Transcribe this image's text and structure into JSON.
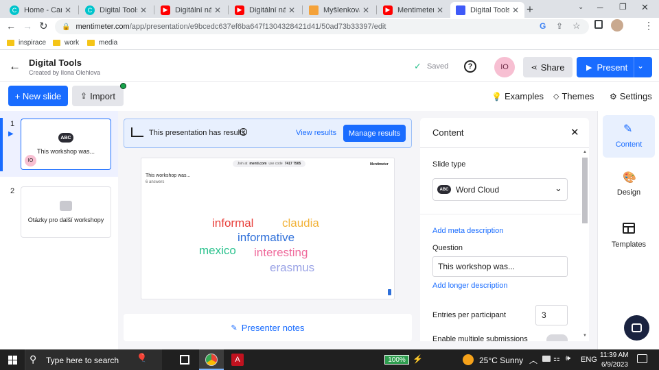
{
  "browser": {
    "tabs": [
      {
        "title": "Home - Canva",
        "icon": "canva-icon",
        "color": "#00c4cc"
      },
      {
        "title": "Digital Tools - M",
        "icon": "canva-icon",
        "color": "#00c4cc"
      },
      {
        "title": "Digitální nástr",
        "icon": "youtube-icon",
        "color": "#ff0000"
      },
      {
        "title": "Digitální nástr",
        "icon": "youtube-icon",
        "color": "#ff0000"
      },
      {
        "title": "Myšlenková M",
        "icon": "docs-icon",
        "color": "#f4a23a"
      },
      {
        "title": "Mentimeter in",
        "icon": "youtube-icon",
        "color": "#ff0000"
      },
      {
        "title": "Digital Tools - I",
        "icon": "mentimeter-icon",
        "color": "#3f5af8",
        "active": true
      }
    ],
    "url_domain": "mentimeter.com",
    "url_path": "/app/presentation/e9bcedc637ef6ba647f1304328421d41/50ad73b33397/edit",
    "bookmarks": [
      "inspirace",
      "work",
      "media"
    ]
  },
  "header": {
    "title": "Digital Tools",
    "subtitle": "Created by Ilona Olehlova",
    "saved": "Saved",
    "avatar": "IO",
    "share": "Share",
    "present": "Present"
  },
  "actions": {
    "new_slide": "+ New slide",
    "import": "Import",
    "examples": "Examples",
    "themes": "Themes",
    "settings": "Settings"
  },
  "slides": [
    {
      "number": "1",
      "label": "This workshop was...",
      "badge": "IO"
    },
    {
      "number": "2",
      "label": "Otázky pro další workshopy"
    }
  ],
  "results_bar": {
    "text": "This presentation has results",
    "view": "View results",
    "manage": "Manage results"
  },
  "preview": {
    "join_prefix": "Join at",
    "join_site": "menti.com",
    "code_label": "use code",
    "code": "7417 7505",
    "brand": "Mentimeter",
    "question": "This workshop was...",
    "answers": "6 answers",
    "words": [
      {
        "text": "informal",
        "color": "#e8413c"
      },
      {
        "text": "claudia",
        "color": "#f2b33a"
      },
      {
        "text": "informative",
        "color": "#2e6fd9"
      },
      {
        "text": "mexico",
        "color": "#2cc28e"
      },
      {
        "text": "interesting",
        "color": "#ef6b9c"
      },
      {
        "text": "erasmus",
        "color": "#9aa3e6"
      }
    ]
  },
  "presenter_notes": "Presenter notes",
  "panel": {
    "title": "Content",
    "slide_type_label": "Slide type",
    "slide_type": "Word Cloud",
    "add_meta": "Add meta description",
    "question_label": "Question",
    "question_value": "This workshop was...",
    "add_longer": "Add longer description",
    "entries_label": "Entries per participant",
    "entries_value": "3",
    "multiple_label": "Enable multiple submissions"
  },
  "sidebar": [
    {
      "label": "Content",
      "icon": "pencil-icon"
    },
    {
      "label": "Design",
      "icon": "palette-icon"
    },
    {
      "label": "Templates",
      "icon": "templates-icon"
    }
  ],
  "taskbar": {
    "search": "Type here to search",
    "battery": "100%",
    "weather": "25°C  Sunny",
    "lang": "ENG",
    "time": "11:39 AM",
    "date": "6/9/2023"
  }
}
